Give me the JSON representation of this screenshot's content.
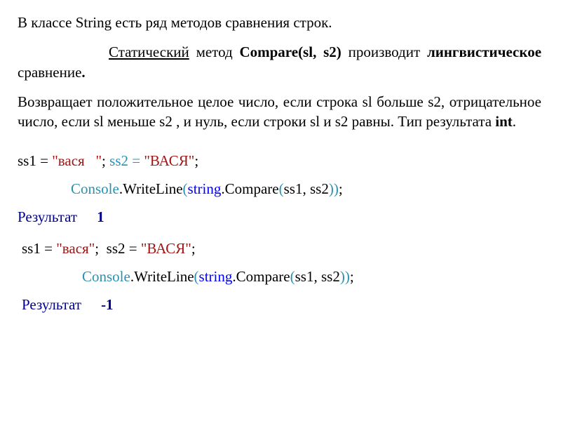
{
  "intro": "В классе String есть ряд методов сравнения строк.",
  "p1": {
    "static_word": "Статический",
    "method_word": " метод   ",
    "compare_sig": "Compare(sl, s2)",
    "tail1": "  производит ",
    "linguistic": "лингвистическое",
    "tail2": " сравнение",
    "dot": "."
  },
  "p2a": "Возвращает положительное целое число, если строка sl больше s2, отрицательное число, если sl меньше s2 , и нуль, если строки sl и s2 равны. Тип результата ",
  "p2b": "int",
  "p2c": ".",
  "code1": {
    "assign": {
      "a1": "ss1 = ",
      "s1": "\"вася   \"",
      "semi1": "; ",
      "a2": "ss2 = ",
      "s2": "\"ВАСЯ\"",
      "semi2": ";"
    },
    "call": {
      "cw": "Console",
      "dot1": ".",
      "wl": "WriteLine",
      "open": "(",
      "str": "string",
      "dot2": ".",
      "cmp": "Compare",
      "open2": "(",
      "args": "ss1, ss2",
      "close": "))",
      "semi": ";"
    },
    "result_label": "Результат",
    "result_value": "1"
  },
  "code2": {
    "assign": {
      "a1": "ss1 = ",
      "s1": "\"вася\"",
      "semi1": ";  ",
      "a2": "ss2 = ",
      "s2": "\"ВАСЯ\"",
      "semi2": ";"
    },
    "call": {
      "cw": "Console",
      "dot1": ".",
      "wl": "WriteLine",
      "open": "(",
      "str": "string",
      "dot2": ".",
      "cmp": "Compare",
      "open2": "(",
      "args": "ss1, ss2",
      "close": "))",
      "semi": ";"
    },
    "result_label": "Результат",
    "result_value": "-1"
  }
}
